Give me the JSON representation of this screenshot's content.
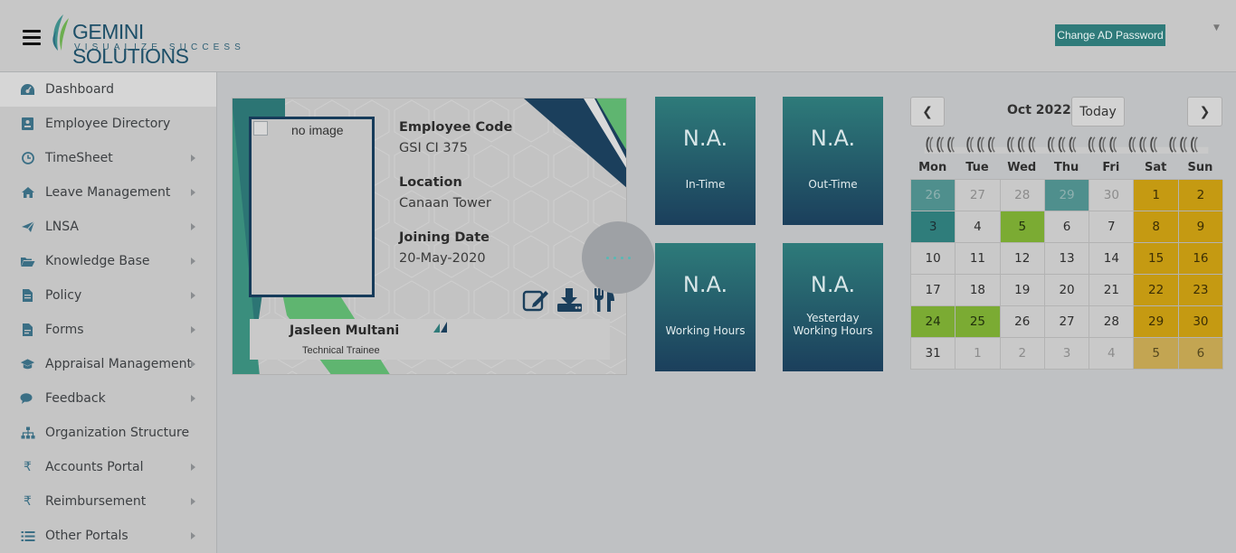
{
  "header": {
    "logo_name": "GEMINI SOLUTIONS",
    "logo_tagline": "VISUALIZE SUCCESS",
    "change_password_label": "Change AD Password",
    "user_menu_icon": "caret-down-icon"
  },
  "sidebar": {
    "items": [
      {
        "label": "Dashboard",
        "icon": "dashboard-icon",
        "has_submenu": false
      },
      {
        "label": "Employee Directory",
        "icon": "id-card-icon",
        "has_submenu": false
      },
      {
        "label": "TimeSheet",
        "icon": "clock-icon",
        "has_submenu": true
      },
      {
        "label": "Leave Management",
        "icon": "home-icon",
        "has_submenu": true
      },
      {
        "label": "LNSA",
        "icon": "paper-plane-icon",
        "has_submenu": true
      },
      {
        "label": "Knowledge Base",
        "icon": "folder-open-icon",
        "has_submenu": true
      },
      {
        "label": "Policy",
        "icon": "document-icon",
        "has_submenu": true
      },
      {
        "label": "Forms",
        "icon": "file-icon",
        "has_submenu": true
      },
      {
        "label": "Appraisal Management",
        "icon": "graduation-cap-icon",
        "has_submenu": true
      },
      {
        "label": "Feedback",
        "icon": "comments-icon",
        "has_submenu": true
      },
      {
        "label": "Organization Structure",
        "icon": "sitemap-icon",
        "has_submenu": false
      },
      {
        "label": "Accounts Portal",
        "icon": "rupee-icon",
        "has_submenu": true
      },
      {
        "label": "Reimbursement",
        "icon": "rupee-icon",
        "has_submenu": true
      },
      {
        "label": "Other Portals",
        "icon": "list-icon",
        "has_submenu": true
      }
    ]
  },
  "profile": {
    "photo_alt": "no image",
    "employee_code_label": "Employee Code",
    "employee_code": "GSI CI 375",
    "location_label": "Location",
    "location": "Canaan Tower",
    "joining_date_label": "Joining Date",
    "joining_date": "20-May-2020",
    "name": "Jasleen Multani",
    "designation": "Technical Trainee",
    "actions": [
      "edit-icon",
      "download-icon",
      "cutlery-icon"
    ]
  },
  "stats": {
    "in_time": {
      "value": "N.A.",
      "label": "In-Time"
    },
    "out_time": {
      "value": "N.A.",
      "label": "Out-Time"
    },
    "working_hours": {
      "value": "N.A.",
      "label": "Working Hours"
    },
    "yesterday_hours": {
      "value": "N.A.",
      "label_line1": "Yesterday",
      "label_line2": "Working Hours"
    }
  },
  "calendar": {
    "title": "Oct 2022",
    "prev_label": "❮",
    "next_label": "❯",
    "today_label": "Today",
    "weekdays": [
      "Mon",
      "Tue",
      "Wed",
      "Thu",
      "Fri",
      "Sat",
      "Sun"
    ],
    "days": [
      {
        "d": "26",
        "other": true,
        "status": "teal"
      },
      {
        "d": "27",
        "other": true,
        "status": ""
      },
      {
        "d": "28",
        "other": true,
        "status": ""
      },
      {
        "d": "29",
        "other": true,
        "status": "teal"
      },
      {
        "d": "30",
        "other": true,
        "status": ""
      },
      {
        "d": "1",
        "other": false,
        "status": "gold"
      },
      {
        "d": "2",
        "other": false,
        "status": "gold"
      },
      {
        "d": "3",
        "other": false,
        "status": "teal"
      },
      {
        "d": "4",
        "other": false,
        "status": ""
      },
      {
        "d": "5",
        "other": false,
        "status": "green"
      },
      {
        "d": "6",
        "other": false,
        "status": ""
      },
      {
        "d": "7",
        "other": false,
        "status": ""
      },
      {
        "d": "8",
        "other": false,
        "status": "gold"
      },
      {
        "d": "9",
        "other": false,
        "status": "gold"
      },
      {
        "d": "10",
        "other": false,
        "status": ""
      },
      {
        "d": "11",
        "other": false,
        "status": ""
      },
      {
        "d": "12",
        "other": false,
        "status": ""
      },
      {
        "d": "13",
        "other": false,
        "status": ""
      },
      {
        "d": "14",
        "other": false,
        "status": ""
      },
      {
        "d": "15",
        "other": false,
        "status": "gold"
      },
      {
        "d": "16",
        "other": false,
        "status": "gold"
      },
      {
        "d": "17",
        "other": false,
        "status": ""
      },
      {
        "d": "18",
        "other": false,
        "status": ""
      },
      {
        "d": "19",
        "other": false,
        "status": ""
      },
      {
        "d": "20",
        "other": false,
        "status": ""
      },
      {
        "d": "21",
        "other": false,
        "status": ""
      },
      {
        "d": "22",
        "other": false,
        "status": "gold"
      },
      {
        "d": "23",
        "other": false,
        "status": "gold"
      },
      {
        "d": "24",
        "other": false,
        "status": "green"
      },
      {
        "d": "25",
        "other": false,
        "status": "green"
      },
      {
        "d": "26",
        "other": false,
        "status": ""
      },
      {
        "d": "27",
        "other": false,
        "status": ""
      },
      {
        "d": "28",
        "other": false,
        "status": ""
      },
      {
        "d": "29",
        "other": false,
        "status": "gold"
      },
      {
        "d": "30",
        "other": false,
        "status": "gold"
      },
      {
        "d": "31",
        "other": false,
        "status": ""
      },
      {
        "d": "1",
        "other": true,
        "status": ""
      },
      {
        "d": "2",
        "other": true,
        "status": ""
      },
      {
        "d": "3",
        "other": true,
        "status": ""
      },
      {
        "d": "4",
        "other": true,
        "status": ""
      },
      {
        "d": "5",
        "other": true,
        "status": "gold"
      },
      {
        "d": "6",
        "other": true,
        "status": "gold"
      }
    ]
  },
  "colors": {
    "accent_teal": "#2f7b7a",
    "accent_navy": "#1b3f5c",
    "holiday_gold": "#c59a12",
    "present_green": "#7bab33"
  }
}
